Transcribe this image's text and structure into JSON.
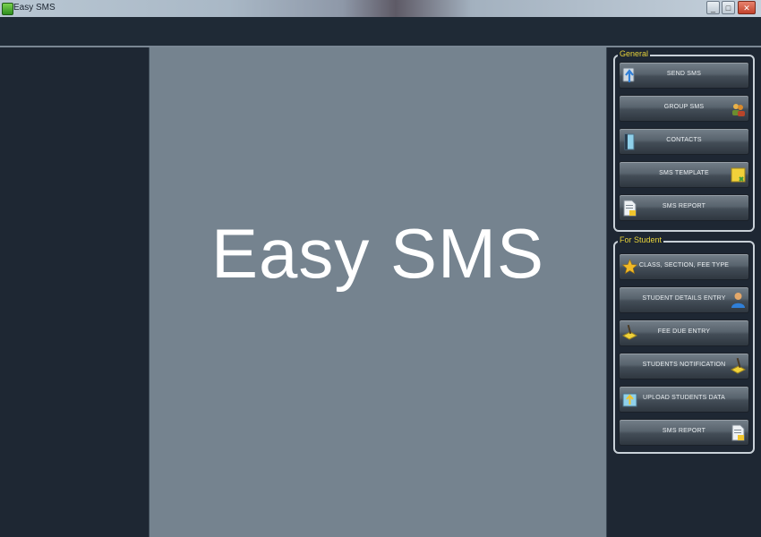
{
  "window": {
    "title": "Easy SMS",
    "minimize_glyph": "_",
    "maximize_glyph": "□",
    "close_glyph": "✕"
  },
  "main": {
    "title": "Easy SMS"
  },
  "general": {
    "legend": "General",
    "buttons": [
      {
        "label": "SEND SMS",
        "icon": "phone-upload-icon"
      },
      {
        "label": "GROUP SMS",
        "icon": "people-icon"
      },
      {
        "label": "CONTACTS",
        "icon": "contacts-book-icon"
      },
      {
        "label": "SMS TEMPLATE",
        "icon": "template-note-icon"
      },
      {
        "label": "SMS REPORT",
        "icon": "report-document-icon"
      }
    ]
  },
  "student": {
    "legend": "For Student",
    "buttons": [
      {
        "label": "CLASS, SECTION, FEE TYPE",
        "icon": "star-icon"
      },
      {
        "label": "STUDENT DETAILS ENTRY",
        "icon": "student-person-icon"
      },
      {
        "label": "FEE DUE ENTRY",
        "icon": "fee-pencil-icon"
      },
      {
        "label": "STUDENTS NOTIFICATION",
        "icon": "notification-pencil-icon"
      },
      {
        "label": "UPLOAD STUDENTS DATA",
        "icon": "upload-data-icon"
      },
      {
        "label": "SMS REPORT",
        "icon": "report-document-icon"
      }
    ]
  },
  "colors": {
    "background": "#1e2733",
    "center_panel": "#75838f",
    "legend_text": "#e6d23a",
    "button_text": "#e9edf0"
  }
}
